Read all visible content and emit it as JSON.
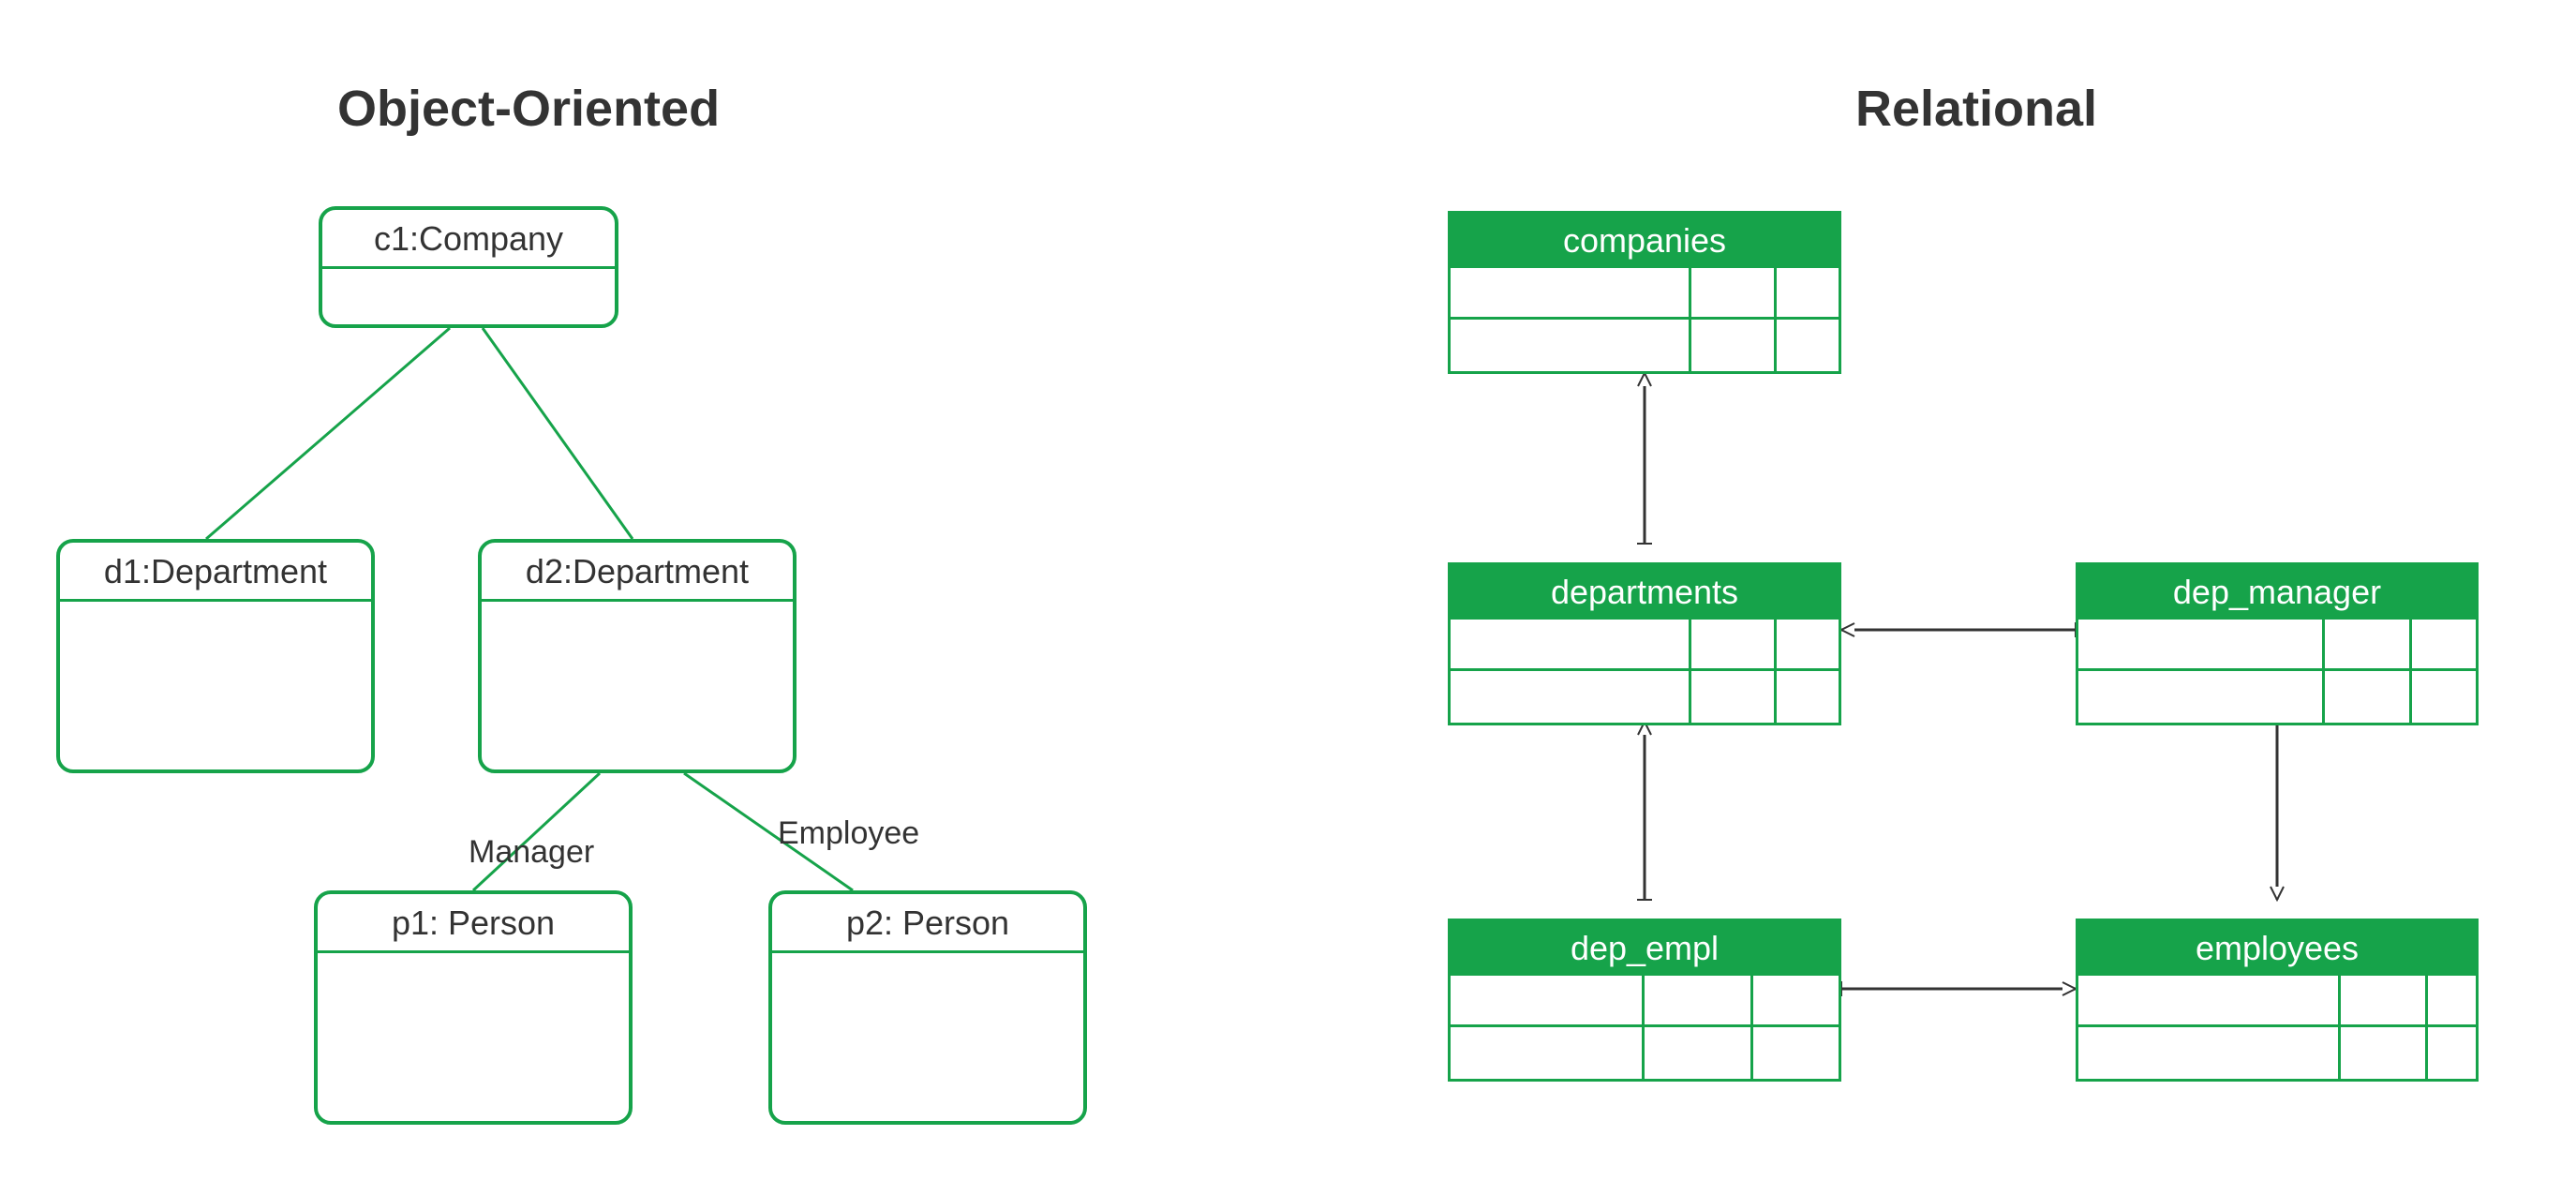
{
  "left": {
    "title": "Object-Oriented",
    "objects": {
      "company": "c1:Company",
      "dept1": "d1:Department",
      "dept2": "d2:Department",
      "person1": "p1: Person",
      "person2": "p2: Person"
    },
    "edgeLabels": {
      "manager": "Manager",
      "employee": "Employee"
    }
  },
  "right": {
    "title": "Relational",
    "tables": {
      "companies": "companies",
      "departments": "departments",
      "dep_manager": "dep_manager",
      "dep_empl": "dep_empl",
      "employees": "employees"
    }
  }
}
